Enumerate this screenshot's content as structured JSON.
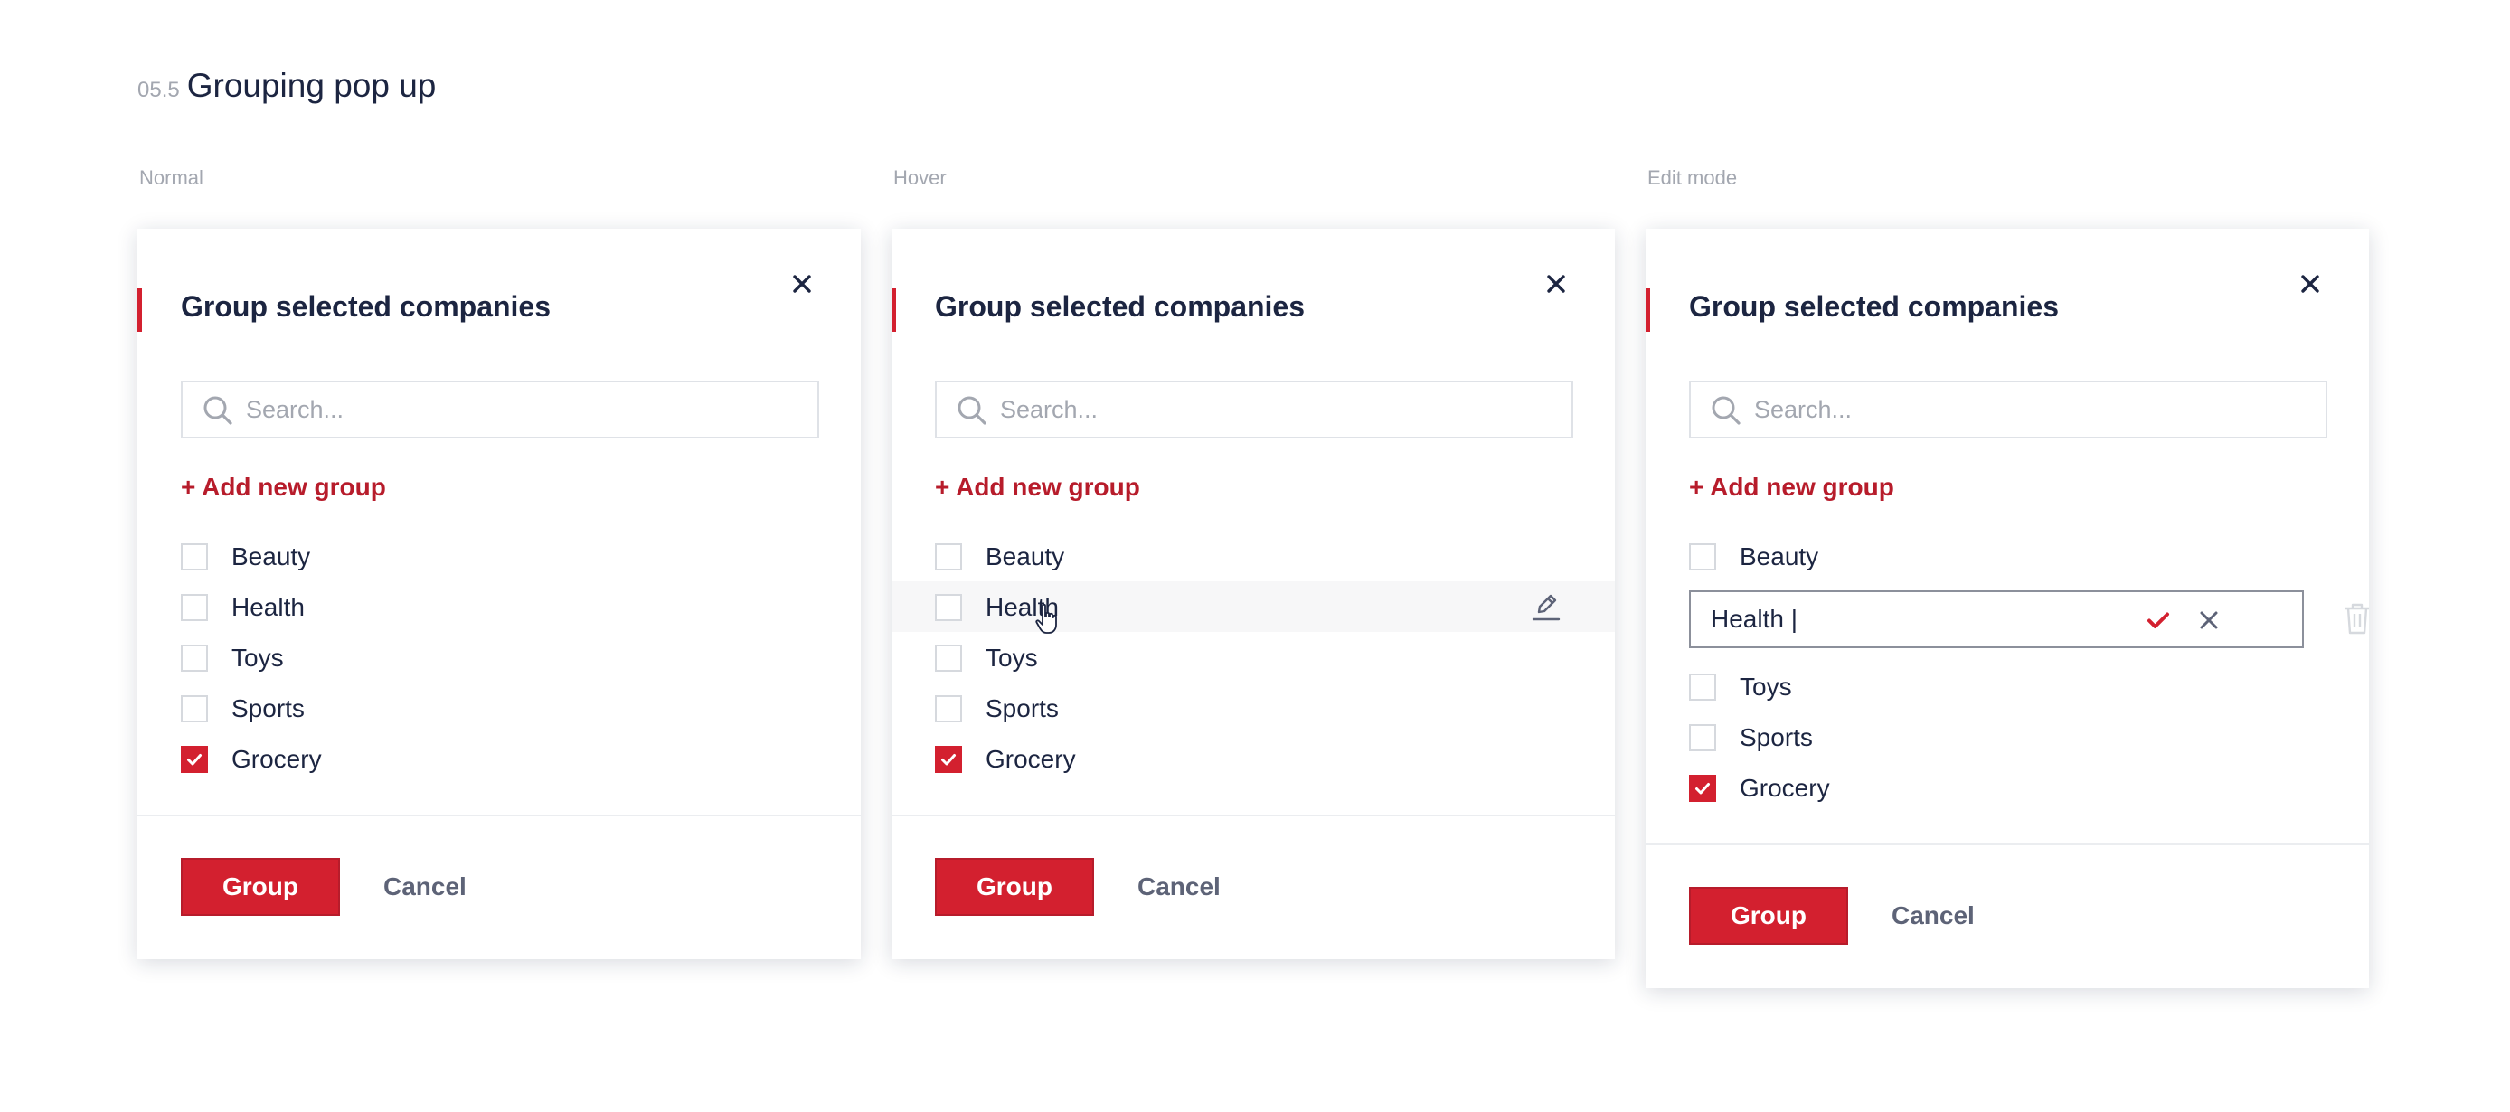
{
  "page": {
    "number": "05.5",
    "title": "Grouping pop up"
  },
  "states": [
    "Normal",
    "Hover",
    "Edit mode"
  ],
  "dialog": {
    "title": "Group selected companies",
    "search_placeholder": "Search...",
    "add_group_label": "+ Add new group",
    "group_button": "Group",
    "cancel_button": "Cancel"
  },
  "items": [
    {
      "label": "Beauty",
      "checked": false
    },
    {
      "label": "Health",
      "checked": false
    },
    {
      "label": "Toys",
      "checked": false
    },
    {
      "label": "Sports",
      "checked": false
    },
    {
      "label": "Grocery",
      "checked": true
    }
  ],
  "edit": {
    "value": "Health |"
  },
  "icons": {
    "close": "close-icon",
    "search": "search-icon",
    "edit": "pencil-icon",
    "confirm": "check-icon",
    "cancel": "close-icon",
    "delete": "trash-icon",
    "checkbox": "checkmark-icon",
    "cursor": "hand-pointer-icon"
  },
  "colors": {
    "accent": "#d3202f",
    "accent_dark": "#b71c2b",
    "text": "#1c2541",
    "muted": "#a3a7b0"
  }
}
